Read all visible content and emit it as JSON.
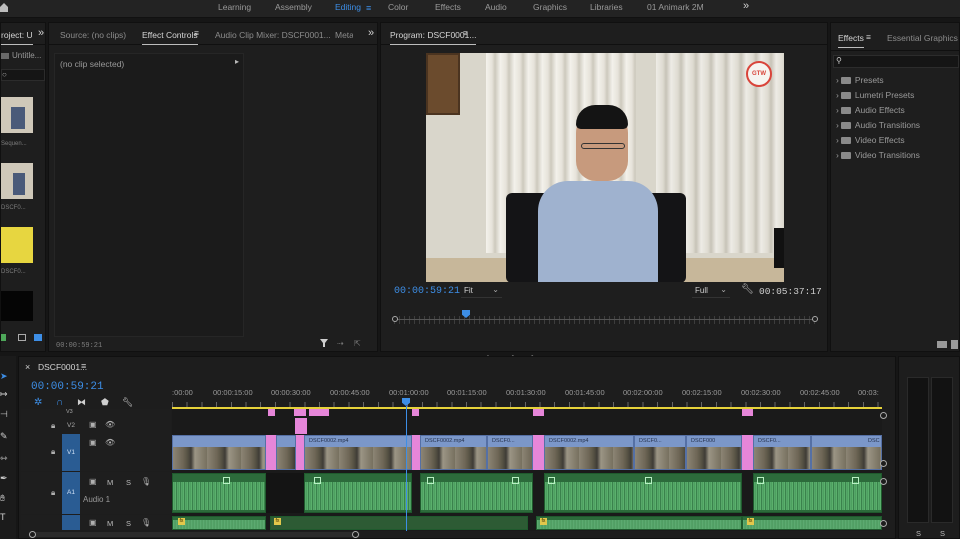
{
  "workspaces": {
    "items": [
      "Learning",
      "Assembly",
      "Editing",
      "Color",
      "Effects",
      "Audio",
      "Graphics",
      "Libraries",
      "01 Animark 2M"
    ],
    "active": "Editing",
    "more": "»"
  },
  "project": {
    "tab": "roject: U",
    "more": "»",
    "item_label": "Untitle...",
    "thumb_labels": [
      "Sequen...",
      "DSCF0...",
      "DSCF0...",
      ""
    ]
  },
  "source": {
    "tabs": [
      "Source: (no clips)",
      "Effect Controls",
      "Audio Clip Mixer: DSCF0001...",
      "Metad"
    ],
    "more": "»",
    "no_clip": "(no clip selected)",
    "timecode": "00:00:59:21"
  },
  "program": {
    "tab": "Program: DSCF0001...",
    "badge": "GTW",
    "timecode": "00:00:59:21",
    "fit": "Fit",
    "quality": "Full",
    "duration": "00:05:37:17"
  },
  "effects": {
    "tabs": [
      "Effects",
      "Essential Graphics"
    ],
    "folders": [
      "Presets",
      "Lumetri Presets",
      "Audio Effects",
      "Audio Transitions",
      "Video Effects",
      "Video Transitions"
    ]
  },
  "timeline": {
    "tab": "DSCF0001...",
    "timecode": "00:00:59:21",
    "ruler": [
      ":00:00",
      "00:00:15:00",
      "00:00:30:00",
      "00:00:45:00",
      "00:01:00:00",
      "00:01:15:00",
      "00:01:30:00",
      "00:01:45:00",
      "00:02:00:00",
      "00:02:15:00",
      "00:02:30:00",
      "00:02:45:00",
      "00:03:"
    ],
    "tracks": {
      "v3": "V3",
      "v2": "V2",
      "v1": "V1",
      "a1": "A1",
      "a1_name": "Audio 1",
      "m": "M",
      "s": "S"
    },
    "clip_labels": [
      "DSCF0002.mp4",
      "DSCF0002.mp4",
      "DSCF0...",
      "DSCF0002.mp4",
      "DSCF0...",
      "DSCF000",
      "DSCF0...",
      "DSC"
    ]
  },
  "meter": {
    "labels": [
      "S",
      "S"
    ]
  }
}
